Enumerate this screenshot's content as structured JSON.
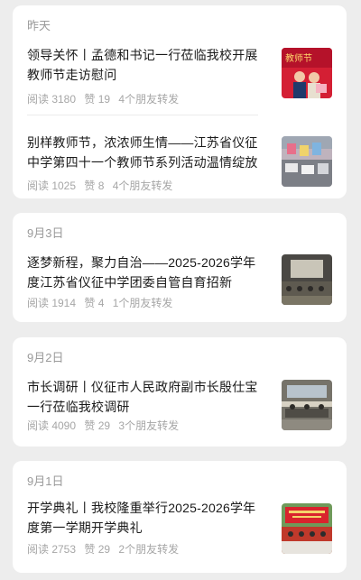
{
  "groups": [
    {
      "date": "昨天",
      "articles": [
        {
          "title": "领导关怀丨孟德和书记一行莅临我校开展教师节走访慰问",
          "reads": "阅读 3180",
          "likes": "赞 19",
          "shares": "4个朋友转发",
          "thumb_text": "教师节",
          "thumb_colors": [
            "#c8102e",
            "#e03a4e"
          ]
        },
        {
          "title": "别样教师节，浓浓师生情——江苏省仪征中学第四十一个教师节系列活动温情绽放",
          "reads": "阅读 1025",
          "likes": "赞 8",
          "shares": "4个朋友转发",
          "thumb_colors": [
            "#c9b8c8",
            "#8a8f9a"
          ]
        }
      ]
    },
    {
      "date": "9月3日",
      "articles": [
        {
          "title": "逐梦新程，聚力自治——2025-2026学年度江苏省仪征中学团委自管自育招新",
          "reads": "阅读 1914",
          "likes": "赞 4",
          "shares": "1个朋友转发",
          "thumb_colors": [
            "#6e6a5f",
            "#3a3a36"
          ]
        }
      ]
    },
    {
      "date": "9月2日",
      "articles": [
        {
          "title": "市长调研丨仪征市人民政府副市长殷仕宝一行莅临我校调研",
          "reads": "阅读 4090",
          "likes": "赞 29",
          "shares": "3个朋友转发",
          "thumb_colors": [
            "#8a8578",
            "#5b5a55"
          ]
        }
      ]
    },
    {
      "date": "9月1日",
      "articles": [
        {
          "title": "开学典礼丨我校隆重举行2025-2026学年度第一学期开学典礼",
          "reads": "阅读 2753",
          "likes": "赞 29",
          "shares": "2个朋友转发",
          "thumb_colors": [
            "#d9232d",
            "#4d8f3f"
          ]
        }
      ]
    }
  ]
}
